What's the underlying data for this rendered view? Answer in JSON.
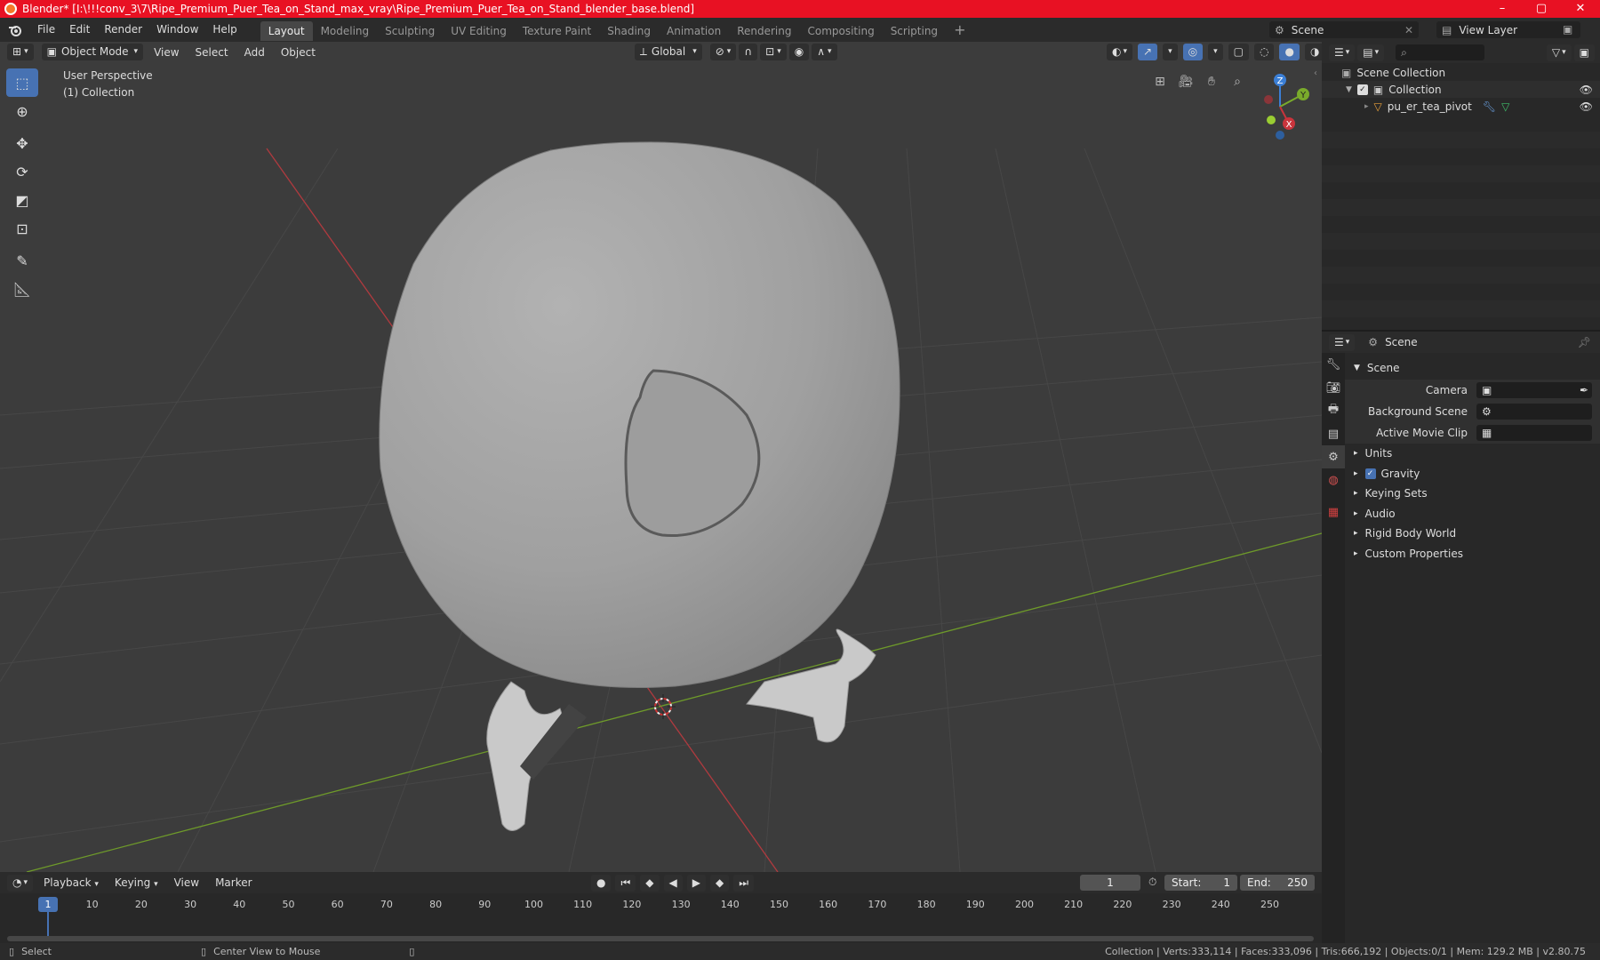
{
  "window": {
    "title": "Blender* [I:\\!!!conv_3\\7\\Ripe_Premium_Puer_Tea_on_Stand_max_vray\\Ripe_Premium_Puer_Tea_on_Stand_blender_base.blend]",
    "minimize": "–",
    "maximize": "▢",
    "close": "✕"
  },
  "menubar": {
    "items": [
      "File",
      "Edit",
      "Render",
      "Window",
      "Help"
    ]
  },
  "workspaces": {
    "tabs": [
      "Layout",
      "Modeling",
      "Sculpting",
      "UV Editing",
      "Texture Paint",
      "Shading",
      "Animation",
      "Rendering",
      "Compositing",
      "Scripting"
    ],
    "active": "Layout",
    "add": "+"
  },
  "scene_selector": {
    "value": "Scene"
  },
  "view_layer_selector": {
    "value": "View Layer"
  },
  "viewport": {
    "mode": "Object Mode",
    "menus": [
      "View",
      "Select",
      "Add",
      "Object"
    ],
    "transform_orientation": "Global",
    "overlay_title": "User Perspective",
    "overlay_subtitle": "(1) Collection",
    "gizmo_axes": {
      "z": "Z",
      "y": "Y",
      "x": "X"
    }
  },
  "outliner": {
    "search_placeholder": "",
    "root": "Scene Collection",
    "collection": "Collection",
    "object": "pu_er_tea_pivot"
  },
  "properties": {
    "header": "Scene",
    "panel_title": "Scene",
    "fields": [
      {
        "label": "Camera",
        "value": ""
      },
      {
        "label": "Background Scene",
        "value": ""
      },
      {
        "label": "Active Movie Clip",
        "value": ""
      }
    ],
    "sections": [
      "Units",
      "Gravity",
      "Keying Sets",
      "Audio",
      "Rigid Body World",
      "Custom Properties"
    ]
  },
  "timeline": {
    "menus": [
      "Playback",
      "Keying",
      "View",
      "Marker"
    ],
    "current_frame": "1",
    "start_label": "Start:",
    "start": "1",
    "end_label": "End:",
    "end": "250",
    "ticks": [
      "1",
      "10",
      "20",
      "30",
      "40",
      "50",
      "60",
      "70",
      "80",
      "90",
      "100",
      "110",
      "120",
      "130",
      "140",
      "150",
      "160",
      "170",
      "180",
      "190",
      "200",
      "210",
      "220",
      "230",
      "240",
      "250"
    ]
  },
  "statusbar": {
    "left": "Select",
    "middle": "Center View to Mouse",
    "right": "Collection | Verts:333,114 | Faces:333,096 | Tris:666,192 | Objects:0/1 | Mem: 129.2 MB | v2.80.75"
  },
  "colors": {
    "titlebar": "#e81123",
    "accent": "#4772b3",
    "x_axis": "#c9343c",
    "y_axis": "#7aab2b",
    "z_axis": "#3b7fd6"
  }
}
